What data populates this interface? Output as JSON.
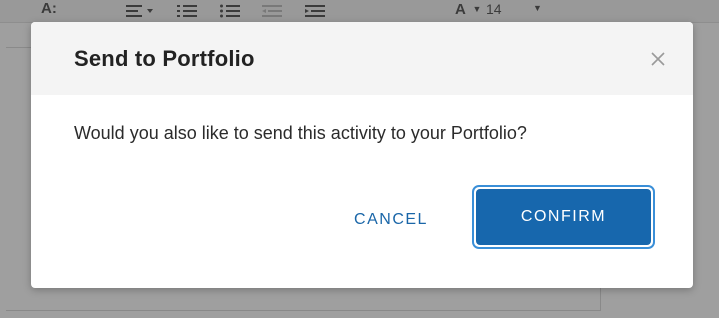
{
  "toolbar": {
    "font_color_label": "A:",
    "text_color_label": "A",
    "font_size_value": "14"
  },
  "modal": {
    "title": "Send to Portfolio",
    "close_glyph": "×",
    "message": "Would you also like to send this activity to your Portfolio?",
    "cancel_label": "CANCEL",
    "confirm_label": "CONFIRM"
  },
  "colors": {
    "primary": "#1767ad",
    "focus_ring": "#3a8fd8",
    "link_text": "#1a66a8",
    "header_bg": "#f4f4f4",
    "overlay": "#505050"
  },
  "icons": [
    "align-dropdown-icon",
    "ordered-list-icon",
    "unordered-list-icon",
    "outdent-icon",
    "indent-icon",
    "chevron-down-icon",
    "close-icon"
  ]
}
